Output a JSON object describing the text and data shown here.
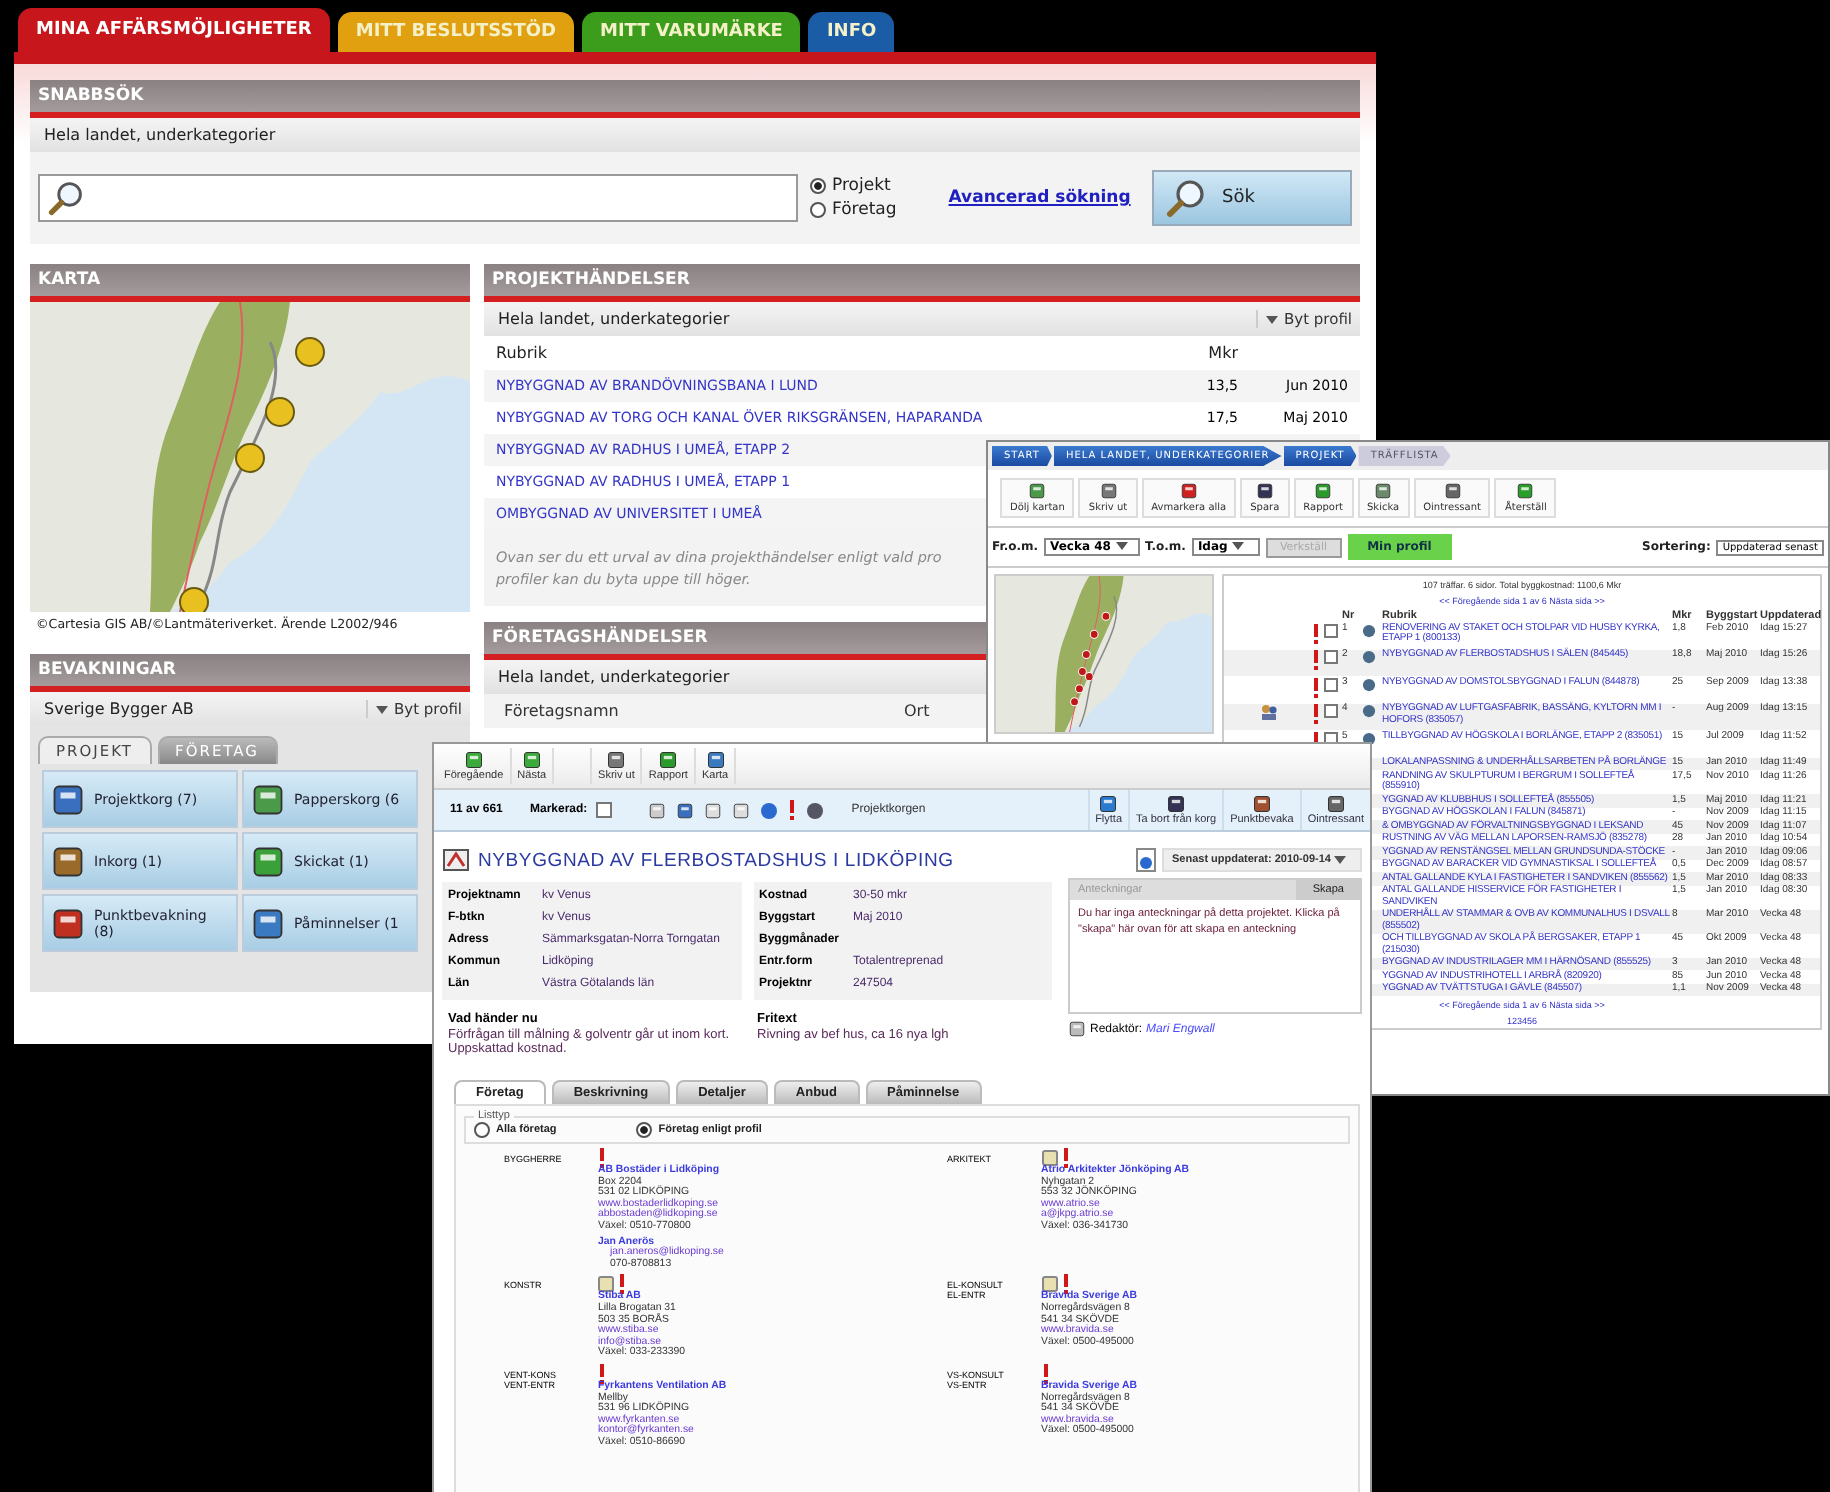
{
  "main_tabs": [
    {
      "label": "MINA AFFÄRSMÖJLIGHETER",
      "selected": true,
      "color": "#c8161d"
    },
    {
      "label": "MITT BESLUTSSTÖD",
      "selected": false,
      "color": "#e0a010"
    },
    {
      "label": "MITT VARUMÄRKE",
      "selected": false,
      "color": "#3c9c1c"
    },
    {
      "label": "INFO",
      "selected": false,
      "color": "#1b5ca6"
    }
  ],
  "snabbsok": {
    "title": "SNABBSÖK",
    "scope": "Hela landet, underkategorier",
    "radios": [
      {
        "label": "Projekt",
        "selected": true
      },
      {
        "label": "Företag",
        "selected": false
      }
    ],
    "advanced_link": "Avancerad sökning",
    "search_button": "Sök"
  },
  "karta": {
    "title": "KARTA",
    "credit": "©Cartesia GIS AB/©Lantmäteriverket. Ärende L2002/946"
  },
  "projekthandelser": {
    "title": "PROJEKTHÄNDELSER",
    "scope": "Hela landet, underkategorier",
    "profile_button": "Byt profil",
    "columns": [
      "Rubrik",
      "Mkr"
    ],
    "rows": [
      {
        "rubrik": "NYBYGGNAD AV BRANDÖVNINGSBANA I LUND",
        "mkr": "13,5",
        "date": "Jun 2010"
      },
      {
        "rubrik": "NYBYGGNAD AV TORG OCH KANAL ÖVER RIKSGRÄNSEN, HAPARANDA",
        "mkr": "17,5",
        "date": "Maj 2010"
      },
      {
        "rubrik": "NYBYGGNAD AV RADHUS I UMEÅ, ETAPP 2"
      },
      {
        "rubrik": "NYBYGGNAD AV RADHUS I UMEÅ, ETAPP 1"
      },
      {
        "rubrik": "OMBYGGNAD AV UNIVERSITET I UMEÅ"
      }
    ],
    "note_lines": [
      "Ovan ser du ett urval av dina projekthändelser enligt vald pro",
      "profiler kan du byta uppe till höger."
    ]
  },
  "bevakningar": {
    "title": "BEVAKNINGAR",
    "profile": "Sverige Bygger AB",
    "profile_button": "Byt profil",
    "tabs": [
      {
        "label": "PROJEKT",
        "selected": true
      },
      {
        "label": "FÖRETAG",
        "selected": false
      }
    ],
    "tiles": [
      "Projektkorg (7)",
      "Papperskorg (6",
      "Inkorg (1)",
      "Skickat (1)",
      "Punktbevakning (8)",
      "Påminnelser (1"
    ]
  },
  "foretagshandelser": {
    "title": "FÖRETAGSHÄNDELSER",
    "scope": "Hela landet, underkategorier",
    "columns": [
      "Företagsnamn",
      "Ort"
    ]
  },
  "trafflista": {
    "breadcrumb": [
      "START",
      "HELA LANDET, UNDERKATEGORIER",
      "PROJEKT",
      "TRÄFFLISTA"
    ],
    "toolbar": [
      "Dölj kartan",
      "Skriv ut",
      "Avmarkera alla",
      "Spara",
      "Rapport",
      "Skicka",
      "Ointressant",
      "Återställ"
    ],
    "from_label": "Fr.o.m.",
    "from": "Vecka 48",
    "to_label": "T.o.m.",
    "to": "Idag",
    "apply_button": {
      "label": "Verkställ",
      "disabled": true
    },
    "profile_button": "Min profil",
    "sort_label": "Sortering:",
    "sort": "Uppdaterad senast",
    "summary": "107 träffar. 6 sidor. Total byggkostnad: 1100,6 Mkr",
    "pager": "<< Föregående sida   1 av 6   Nästa sida >>",
    "pager_bottom": "<< Föregående sida   1 av 6   Nästa sida >>",
    "columns": [
      "Nr",
      "Rubrik",
      "Mkr",
      "Byggstart",
      "Uppdaterad"
    ],
    "rows": [
      {
        "nr": "1",
        "checked": false,
        "rubrik": "RENOVERING AV STAKET OCH STOLPAR VID HUSBY KYRKA, ETAPP 1 (800133)",
        "mkr": "1,8",
        "start": "Feb 2010",
        "updated": "Idag 15:27"
      },
      {
        "nr": "2",
        "checked": false,
        "rubrik": "NYBYGGNAD AV FLERBOSTADSHUS I SÄLEN (845445)",
        "mkr": "18,8",
        "start": "Maj 2010",
        "updated": "Idag 15:26"
      },
      {
        "nr": "3",
        "checked": false,
        "rubrik": "NYBYGGNAD AV DOMSTOLSBYGGNAD I FALUN (844878)",
        "mkr": "25",
        "start": "Sep 2009",
        "updated": "Idag 13:38"
      },
      {
        "nr": "4",
        "checked": false,
        "rubrik": "NYBYGGNAD AV LUFTGASFABRIK, BASSÄNG, KYLTORN MM I HOFORS (835057)",
        "mkr": "-",
        "start": "Aug 2009",
        "updated": "Idag 13:15"
      },
      {
        "nr": "5",
        "checked": false,
        "rubrik": "TILLBYGGNAD AV HÖGSKOLA I BORLÄNGE, ETAPP 2 (835051)",
        "mkr": "15",
        "start": "Jul 2009",
        "updated": "Idag 11:52"
      },
      {
        "rubrik": "LOKALANPASSNING & UNDERHÅLLSARBETEN PÅ BORLÄNGE",
        "mkr": "15",
        "start": "Jan 2010",
        "updated": "Idag 11:49"
      },
      {
        "rubrik": "RANDNING AV SKULPTURUM I BERGRUM I SOLLEFTEÅ (855910)",
        "mkr": "17,5",
        "start": "Nov 2010",
        "updated": "Idag 11:26"
      },
      {
        "rubrik": "YGGNAD AV KLUBBHUS I SOLLEFTEÅ (855505)",
        "mkr": "1,5",
        "start": "Maj 2010",
        "updated": "Idag 11:21"
      },
      {
        "rubrik": "BYGGNAD AV HÖGSKOLAN I FALUN (845871)",
        "mkr": "-",
        "start": "Nov 2009",
        "updated": "Idag 11:15"
      },
      {
        "rubrik": "& OMBYGGNAD AV FÖRVALTNINGSBYGGNAD I LEKSAND",
        "mkr": "45",
        "start": "Nov 2009",
        "updated": "Idag 11:07"
      },
      {
        "rubrik": "RUSTNING AV VÄG MELLAN LAPORSEN-RAMSJÖ (835278)",
        "mkr": "28",
        "start": "Jan 2010",
        "updated": "Idag 10:54"
      },
      {
        "rubrik": "YGGNAD AV RENSTÄNGSEL MELLAN GRUNDSUNDA-STÖCKE",
        "mkr": "-",
        "start": "Jan 2010",
        "updated": "Idag 09:06"
      },
      {
        "rubrik": "BYGGNAD AV BARACKER VID GYMNASTIKSAL I SOLLEFTEÅ",
        "mkr": "0,5",
        "start": "Dec 2009",
        "updated": "Idag 08:57"
      },
      {
        "rubrik": "ANTAL GALLANDE KYLA I FASTIGHETER I SANDVIKEN (855562)",
        "mkr": "1,5",
        "start": "Mar 2010",
        "updated": "Idag 08:33"
      },
      {
        "rubrik": "ANTAL GALLANDE HISSERVICE FÖR FASTIGHETER I SANDVIKEN",
        "mkr": "1,5",
        "start": "Jan 2010",
        "updated": "Idag 08:30"
      },
      {
        "rubrik": "UNDERHÅLL AV STAMMAR & OVB AV KOMMUNALHUS I DSVALL (855502)",
        "mkr": "8",
        "start": "Mar 2010",
        "updated": "Vecka 48"
      },
      {
        "rubrik": "OCH TILLBYGGNAD AV SKOLA PÅ BERGSAKER, ETAPP 1 (215030)",
        "mkr": "45",
        "start": "Okt 2009",
        "updated": "Vecka 48"
      },
      {
        "rubrik": "BYGGNAD AV INDUSTRILAGER MM I HÄRNÖSAND (855525)",
        "mkr": "3",
        "start": "Jan 2010",
        "updated": "Vecka 48"
      },
      {
        "rubrik": "YGGNAD AV INDUSTRIHOTELL I ARBRÅ (820920)",
        "mkr": "85",
        "start": "Jun 2010",
        "updated": "Vecka 48"
      },
      {
        "rubrik": "YGGNAD AV TVÄTTSTUGA I GÄVLE (845507)",
        "mkr": "1,1",
        "start": "Nov 2009",
        "updated": "Vecka 48"
      }
    ],
    "pages": "123456"
  },
  "detalj": {
    "toolbar": [
      "Föregående",
      "Nästa",
      "Skriv ut",
      "Rapport",
      "Karta"
    ],
    "position": "11 av 661",
    "marked_label": "Markerad:",
    "marked": false,
    "basket": "Projektkorgen",
    "actions": [
      "Flytta",
      "Ta bort från korg",
      "Punktbevaka",
      "Ointressant"
    ],
    "title": "NYBYGGNAD AV FLERBOSTADSHUS I LIDKÖPING",
    "updated": "Senast uppdaterat: 2010-09-14",
    "facts_left": [
      {
        "label": "Projektnamn",
        "value": "kv Venus"
      },
      {
        "label": "F-btkn",
        "value": "kv Venus"
      },
      {
        "label": "Adress",
        "value": "Sämmarksgatan-Norra Torngatan"
      },
      {
        "label": "Kommun",
        "value": "Lidköping"
      },
      {
        "label": "Län",
        "value": "Västra Götalands län"
      }
    ],
    "facts_right": [
      {
        "label": "Kostnad",
        "value": "30-50 mkr"
      },
      {
        "label": "Byggstart",
        "value": "Maj 2010"
      },
      {
        "label": "Byggmånader"
      },
      {
        "label": "Entr.form",
        "value": "Totalentreprenad"
      },
      {
        "label": "Projektnr",
        "value": "247504"
      }
    ],
    "next_title": "Vad händer nu",
    "next_text": "Förfrågan till målning & golventr går ut inom kort. Uppskattad kostnad.",
    "free_title": "Fritext",
    "free_text": "Rivning av bef hus, ca 16 nya lgh",
    "notes_title": "Anteckningar",
    "notes_button": "Skapa",
    "notes_text": "Du har inga anteckningar på detta projektet. Klicka på \"skapa\" här ovan för att skapa en anteckning",
    "editor_label": "Redaktör:",
    "editor": "Mari Engwall",
    "tabs": [
      {
        "label": "Företag",
        "selected": true
      },
      {
        "label": "Beskrivning",
        "selected": false
      },
      {
        "label": "Detaljer",
        "selected": false
      },
      {
        "label": "Anbud",
        "selected": false
      },
      {
        "label": "Påminnelse",
        "selected": false
      }
    ],
    "listtyp": "Listtyp",
    "list_radios": [
      {
        "label": "Alla företag",
        "selected": false
      },
      {
        "label": "Företag enligt profil",
        "selected": true
      }
    ],
    "companies": [
      {
        "roles": [
          "BYGGHERRE"
        ],
        "noted": false,
        "flagged": true,
        "name": "AB Bostäder i Lidköping",
        "lines": [
          {
            "kind": "text",
            "text": "Box 2204"
          },
          {
            "kind": "text",
            "text": "531 02 LIDKÖPING"
          },
          {
            "kind": "link",
            "text": "www.bostaderlidkoping.se"
          },
          {
            "kind": "link",
            "text": "abbostaden@lidkoping.se"
          },
          {
            "kind": "text",
            "text": "Växel: 0510-770800"
          }
        ],
        "contact": {
          "name": "Jan Anerös",
          "email": "jan.aneros@lidkoping.se",
          "phone": "070-8708813"
        }
      },
      {
        "roles": [
          "ARKITEKT"
        ],
        "noted": true,
        "flagged": true,
        "name": "Atrio Arkitekter Jönköping AB",
        "lines": [
          {
            "kind": "text",
            "text": "Nyhgatan 2"
          },
          {
            "kind": "text",
            "text": "553 32 JÖNKÖPING"
          },
          {
            "kind": "link",
            "text": "www.atrio.se"
          },
          {
            "kind": "link",
            "text": "a@jkpg.atrio.se"
          },
          {
            "kind": "text",
            "text": "Växel: 036-341730"
          }
        ]
      },
      {
        "roles": [
          "KONSTR"
        ],
        "noted": true,
        "flagged": true,
        "name": "Stiba AB",
        "lines": [
          {
            "kind": "text",
            "text": "Lilla Brogatan 31"
          },
          {
            "kind": "text",
            "text": "503 35 BORÅS"
          },
          {
            "kind": "link",
            "text": "www.stiba.se"
          },
          {
            "kind": "link",
            "text": "info@stiba.se"
          },
          {
            "kind": "text",
            "text": "Växel: 033-233390"
          }
        ]
      },
      {
        "roles": [
          "EL-KONSULT",
          "EL-ENTR"
        ],
        "noted": true,
        "flagged": true,
        "name": "Bravida Sverige AB",
        "lines": [
          {
            "kind": "text",
            "text": "Norregårdsvägen 8"
          },
          {
            "kind": "text",
            "text": "541 34 SKÖVDE"
          },
          {
            "kind": "link",
            "text": "www.bravida.se"
          },
          {
            "kind": "text",
            "text": "Växel: 0500-495000"
          }
        ]
      },
      {
        "roles": [
          "VENT-KONS",
          "VENT-ENTR"
        ],
        "noted": false,
        "flagged": true,
        "name": "Fyrkantens Ventilation AB",
        "lines": [
          {
            "kind": "text",
            "text": "Mellby"
          },
          {
            "kind": "text",
            "text": "531 96 LIDKÖPING"
          },
          {
            "kind": "link",
            "text": "www.fyrkanten.se"
          },
          {
            "kind": "link",
            "text": "kontor@fyrkanten.se"
          },
          {
            "kind": "text",
            "text": "Växel: 0510-86690"
          }
        ]
      },
      {
        "roles": [
          "VS-KONSULT",
          "VS-ENTR"
        ],
        "noted": false,
        "flagged": true,
        "name": "Bravida Sverige AB",
        "lines": [
          {
            "kind": "text",
            "text": "Norregårdsvägen 8"
          },
          {
            "kind": "text",
            "text": "541 34 SKÖVDE"
          },
          {
            "kind": "link",
            "text": "www.bravida.se"
          },
          {
            "kind": "text",
            "text": "Växel: 0500-495000"
          }
        ]
      }
    ]
  }
}
